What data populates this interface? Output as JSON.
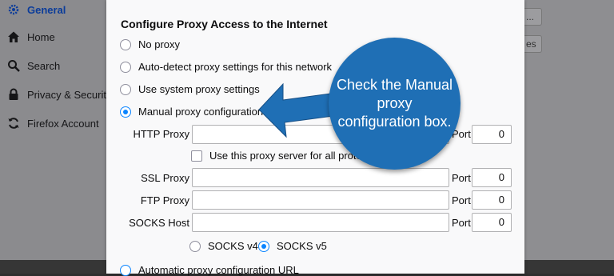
{
  "sidebar": {
    "items": [
      {
        "label": "General",
        "icon": "gear-icon",
        "active": true
      },
      {
        "label": "Home",
        "icon": "home-icon"
      },
      {
        "label": "Search",
        "icon": "search-icon"
      },
      {
        "label": "Privacy & Security",
        "icon": "lock-icon"
      },
      {
        "label": "Firefox Account",
        "icon": "sync-icon"
      }
    ]
  },
  "background_buttons": [
    "...",
    "es"
  ],
  "dialog": {
    "title": "Configure Proxy Access to the Internet",
    "options": [
      {
        "label": "No proxy",
        "checked": false
      },
      {
        "label": "Auto-detect proxy settings for this network",
        "checked": false
      },
      {
        "label": "Use system proxy settings",
        "checked": false
      },
      {
        "label": "Manual proxy configuration",
        "checked": true
      }
    ],
    "http_proxy": {
      "label": "HTTP Proxy",
      "value": "",
      "port_label": "Port",
      "port": "0"
    },
    "share_checkbox": {
      "label": "Use this proxy server for all protocols",
      "checked": false
    },
    "ssl_proxy": {
      "label": "SSL Proxy",
      "value": "",
      "port_label": "Port",
      "port": "0"
    },
    "ftp_proxy": {
      "label": "FTP Proxy",
      "value": "",
      "port_label": "Port",
      "port": "0"
    },
    "socks_host": {
      "label": "SOCKS Host",
      "value": "",
      "port_label": "Port",
      "port": "0"
    },
    "socks_versions": [
      {
        "label": "SOCKS v4",
        "checked": false
      },
      {
        "label": "SOCKS v5",
        "checked": true
      }
    ],
    "auto_config": {
      "label": "Automatic proxy configuration URL",
      "checked": false
    }
  },
  "annotation": {
    "text": "Check the Manual proxy configuration box.",
    "color": "#1f6fb5"
  },
  "colors": {
    "accent": "#0a84ff",
    "active_nav": "#0b3c9a"
  }
}
